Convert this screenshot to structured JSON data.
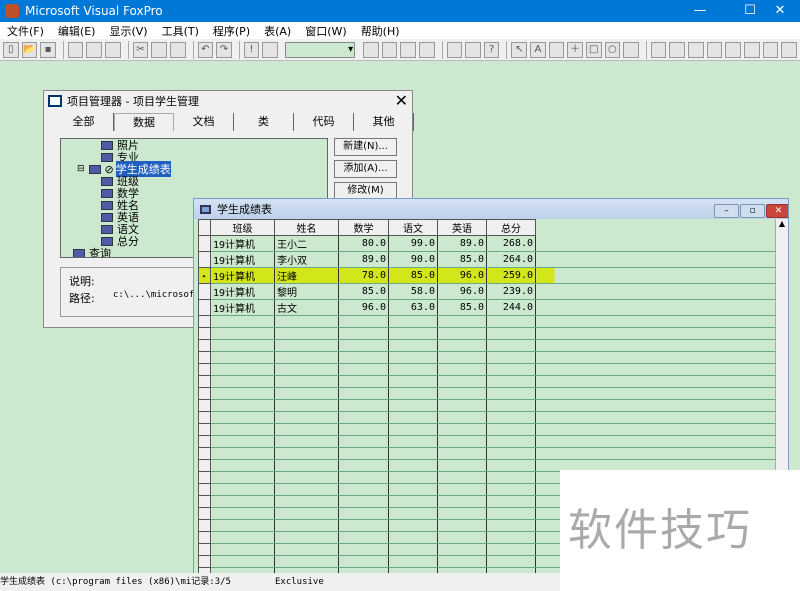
{
  "app": {
    "title": "Microsoft Visual FoxPro",
    "minimize": "—",
    "maximize": "☐",
    "close": "✕"
  },
  "menu": [
    "文件(F)",
    "编辑(E)",
    "显示(V)",
    "工具(T)",
    "程序(P)",
    "表(A)",
    "窗口(W)",
    "帮助(H)"
  ],
  "project_manager": {
    "title": "项目管理器 - 项目学生管理",
    "close": "✕",
    "tabs": [
      "全部",
      "数据",
      "文档",
      "类",
      "代码",
      "其他"
    ],
    "active_tab": "数据",
    "tree": [
      {
        "label": "照片",
        "level": 2
      },
      {
        "label": "专业",
        "level": 2
      },
      {
        "label": "学生成绩表",
        "level": 1,
        "selected": true
      },
      {
        "label": "班级",
        "level": 2
      },
      {
        "label": "数学",
        "level": 2
      },
      {
        "label": "姓名",
        "level": 2
      },
      {
        "label": "英语",
        "level": 2
      },
      {
        "label": "语文",
        "level": 2
      },
      {
        "label": "总分",
        "level": 2
      },
      {
        "label": "查询",
        "level": 0
      }
    ],
    "buttons": [
      "新建(N)...",
      "添加(A)...",
      "修改(M)"
    ],
    "desc_label": "说明:",
    "path_label": "路径:",
    "path_value": "c:\\...\\microsoft v"
  },
  "browse": {
    "title": "学生成绩表",
    "columns": [
      "班级",
      "姓名",
      "数学",
      "语文",
      "英语",
      "总分"
    ],
    "rows": [
      [
        "19计算机",
        "王小二",
        "80.0",
        "99.0",
        "89.0",
        "268.0"
      ],
      [
        "19计算机",
        "李小双",
        "89.0",
        "90.0",
        "85.0",
        "264.0"
      ],
      [
        "19计算机",
        "汪峰",
        "78.0",
        "85.0",
        "96.0",
        "259.0"
      ],
      [
        "19计算机",
        "黎明",
        "85.0",
        "58.0",
        "96.0",
        "239.0"
      ],
      [
        "19计算机",
        "古文",
        "96.0",
        "63.0",
        "85.0",
        "244.0"
      ]
    ],
    "current_row": 3,
    "highlight_color": "#d2e61a"
  },
  "status": {
    "left": "学生成绩表 (c:\\program files (x86)\\mi记录:3/5",
    "mode": "Exclusive"
  },
  "watermark": "软件技巧"
}
